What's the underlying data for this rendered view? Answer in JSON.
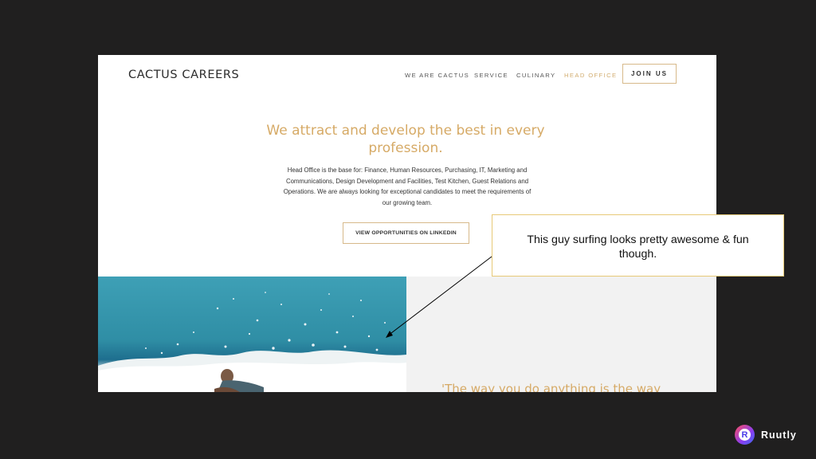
{
  "site": {
    "logo": "CACTUS CAREERS",
    "nav": [
      "WE ARE CACTUS",
      "SERVICE",
      "CULINARY",
      "HEAD OFFICE"
    ],
    "active_nav": "HEAD OFFICE",
    "join_label": "JOIN US"
  },
  "hero": {
    "headline_line1": "We attract and develop the best in every",
    "headline_line2": "profession.",
    "body_lines": [
      "Head Office is the base for: Finance, Human Resources, Purchasing, IT, Marketing and",
      "Communications, Design Development and Facilities, Test Kitchen, Guest Relations and",
      "Operations. We are always looking for exceptional candidates to meet the requirements of",
      "our growing team."
    ],
    "cta_label": "VIEW OPPORTUNITIES ON LINKEDIN"
  },
  "quote_text": "'The way you do anything is the way",
  "annotation": {
    "line1": "This guy surfing looks pretty awesome & fun",
    "line2": "though."
  },
  "brand": {
    "icon_letter": "R",
    "name": "Ruutly"
  },
  "colors": {
    "background": "#201f1f",
    "accent_gold": "#d6aa66",
    "callout_border": "#e7c977",
    "ocean": "#2f8ea5"
  }
}
